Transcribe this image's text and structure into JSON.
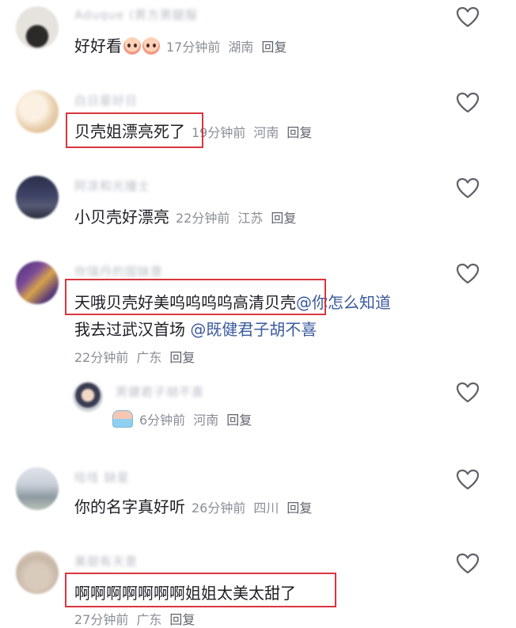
{
  "colors": {
    "highlight": "#d9363e",
    "text": "#1e1f24",
    "meta": "#8a8e96",
    "mention": "#3b5a9c"
  },
  "comments": [
    {
      "username": "Aduque (男方男腿服",
      "text": "好好看",
      "emoji": "cute-face-emoji",
      "time": "17分钟前",
      "location": "湖南",
      "reply": "回复"
    },
    {
      "username": "白日星好日",
      "text": "贝壳姐漂亮死了",
      "time": "19分钟前",
      "location": "河南",
      "reply": "回复"
    },
    {
      "username": "阿凉和光撞士",
      "text": "小贝壳好漂亮",
      "time": "22分钟前",
      "location": "江苏",
      "reply": "回复"
    },
    {
      "username": "你瑞丹的国妹意",
      "line1_text": "天哦贝壳好美呜呜呜呜高清贝壳",
      "line1_mention": "@你怎么知道",
      "line2_text": "我去过武汉首场",
      "line2_mention": "@既健君子胡不喜",
      "time": "22分钟前",
      "location": "广东",
      "reply": "回复"
    },
    {
      "username": "男健君子胡不喜",
      "emoji": "swimming-emoji",
      "time": "6分钟前",
      "location": "河南",
      "reply": "回复"
    },
    {
      "username": "哇哇 缺星",
      "text": "你的名字真好听",
      "time": "26分钟前",
      "location": "四川",
      "reply": "回复"
    },
    {
      "username": "美丽有天意",
      "text": "啊啊啊啊啊啊啊姐姐太美太甜了",
      "time": "27分钟前",
      "location": "广东",
      "reply": "回复"
    }
  ]
}
